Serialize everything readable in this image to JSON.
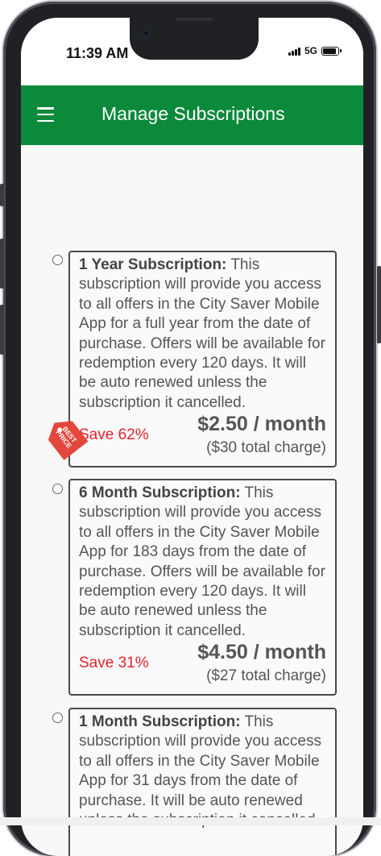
{
  "status_bar": {
    "time": "11:39 AM",
    "network": "5G",
    "signal_icon": "signal-bars-icon",
    "battery_icon": "battery-icon"
  },
  "app_bar": {
    "title": "Manage Subscriptions",
    "menu_icon": "hamburger-menu-icon",
    "color": "#0a8a3a"
  },
  "best_price_tag": {
    "label": "BEST PRICE",
    "color": "#e4473c"
  },
  "subscriptions": [
    {
      "title": "1 Year Subscription:",
      "description": " This subscription will provide you access to all offers in the City Saver Mobile App for a full year from the date of purchase. Offers will be available for redemption every 120 days. It will be auto renewed unless the subscription it cancelled.",
      "save": "Save 62%",
      "price": "$2.50 / month",
      "total": "($30 total charge)",
      "selected": false
    },
    {
      "title": "6 Month Subscription:",
      "description": " This subscription will provide you access to all offers in the City Saver Mobile App for 183 days from the date of purchase. Offers will be available for redemption every 120 days. It will be auto renewed unless the subscription it cancelled.",
      "save": "Save 31%",
      "price": "$4.50 / month",
      "total": "($27 total charge)",
      "selected": false
    },
    {
      "title": "1 Month Subscription:",
      "description": " This subscription will provide you access to all offers in the City Saver Mobile App for 31 days from the date of purchase. It will be auto renewed unless the subscription it cancelled.",
      "selected": false
    }
  ],
  "colors": {
    "save_text": "#e4232d",
    "card_border": "#4a4a4a"
  }
}
